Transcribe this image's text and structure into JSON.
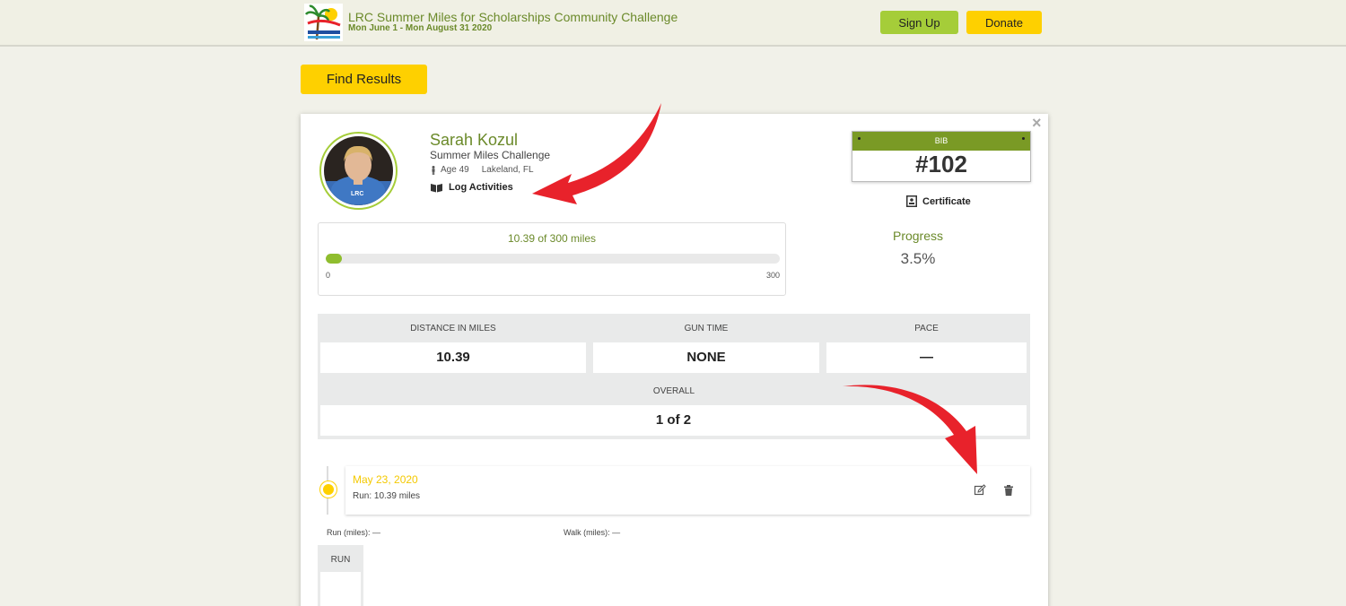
{
  "header": {
    "event_title": "LRC Summer Miles for Scholarships Community Challenge",
    "event_dates": "Mon June 1 - Mon August 31 2020",
    "signup_label": "Sign Up",
    "donate_label": "Donate"
  },
  "find_results_label": "Find Results",
  "close_glyph": "×",
  "participant": {
    "name": "Sarah Kozul",
    "challenge": "Summer Miles Challenge",
    "age": "Age 49",
    "location": "Lakeland, FL",
    "log_activities_label": "Log Activities"
  },
  "bib": {
    "label": "BIB",
    "number": "#102"
  },
  "certificate_label": "Certificate",
  "progress": {
    "label": "Progress",
    "value": "3.5%",
    "fraction": 0.035
  },
  "distance": {
    "text": "10.39 of 300 miles",
    "min": "0",
    "max": "300"
  },
  "stats": {
    "distance_label": "DISTANCE IN MILES",
    "distance_value": "10.39",
    "gun_time_label": "GUN TIME",
    "gun_time_value": "NONE",
    "pace_label": "PACE",
    "pace_value": "—",
    "overall_label": "OVERALL",
    "overall_value": "1 of 2"
  },
  "activity": {
    "date": "May 23, 2020",
    "description": "Run: 10.39 miles"
  },
  "summary": {
    "run_miles": "Run (miles): —",
    "walk_miles": "Walk (miles): —",
    "run_tab_label": "RUN"
  },
  "colors": {
    "brand_green": "#6b8a2a",
    "signup_green": "#a5cd39",
    "yellow": "#fed000",
    "arrow_red": "#e8222b"
  }
}
